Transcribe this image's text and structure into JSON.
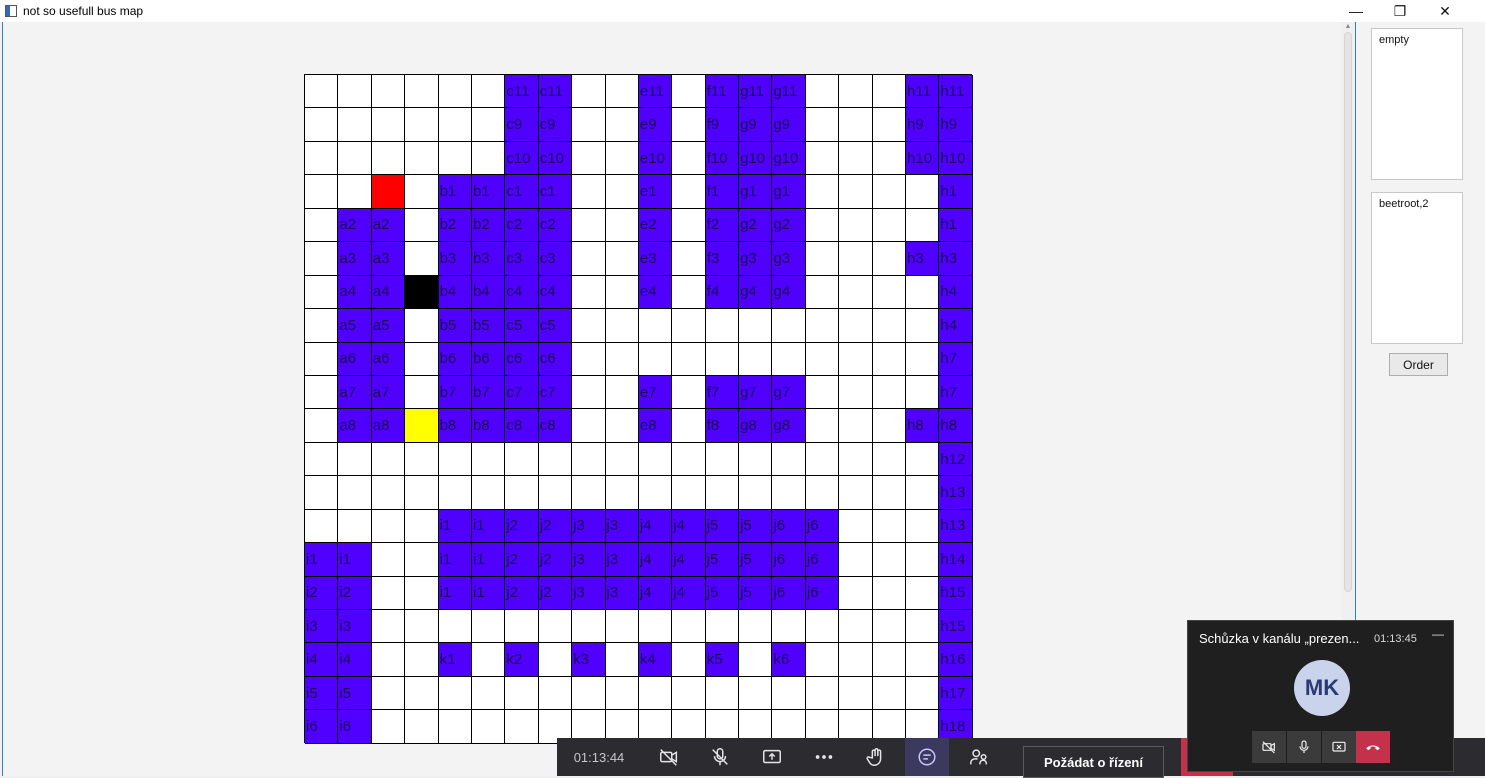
{
  "window": {
    "title": "not so usefull bus map",
    "minimize_glyph": "—",
    "maximize_glyph": "❐",
    "close_glyph": "✕"
  },
  "grid": {
    "rows": [
      [
        "",
        "",
        "",
        "",
        "",
        "",
        "c11:p",
        "c11:p",
        "",
        "",
        "e11:p",
        "",
        "f11:p",
        "g11:p",
        "g11:p",
        "",
        "",
        "",
        "h11:p",
        "h11:p"
      ],
      [
        "",
        "",
        "",
        "",
        "",
        "",
        "c9:p",
        "c9:p",
        "",
        "",
        "e9:p",
        "",
        "f9:p",
        "g9:p",
        "g9:p",
        "",
        "",
        "",
        "h9:p",
        "h9:p"
      ],
      [
        "",
        "",
        "",
        "",
        "",
        "",
        "c10:p",
        "c10:p",
        "",
        "",
        "e10:p",
        "",
        "f10:p",
        "g10:p",
        "g10:p",
        "",
        "",
        "",
        "h10:p",
        "h10:p"
      ],
      [
        "",
        "",
        ":r",
        "",
        "b1:p",
        "b1:p",
        "c1:p",
        "c1:p",
        "",
        "",
        "e1:p",
        "",
        "f1:p",
        "g1:p",
        "g1:p",
        "",
        "",
        "",
        "",
        "h1:p"
      ],
      [
        "",
        "a2:p",
        "a2:p",
        "",
        "b2:p",
        "b2:p",
        "c2:p",
        "c2:p",
        "",
        "",
        "e2:p",
        "",
        "f2:p",
        "g2:p",
        "g2:p",
        "",
        "",
        "",
        "",
        "h1:p"
      ],
      [
        "",
        "a3:p",
        "a3:p",
        "",
        "b3:p",
        "b3:p",
        "c3:p",
        "c3:p",
        "",
        "",
        "e3:p",
        "",
        "f3:p",
        "g3:p",
        "g3:p",
        "",
        "",
        "",
        "h3:p",
        "h3:p"
      ],
      [
        "",
        "a4:p",
        "a4:p",
        ":k",
        "b4:p",
        "b4:p",
        "c4:p",
        "c4:p",
        "",
        "",
        "e4:p",
        "",
        "f4:p",
        "g4:p",
        "g4:p",
        "",
        "",
        "",
        "",
        "h4:p"
      ],
      [
        "",
        "a5:p",
        "a5:p",
        "",
        "b5:p",
        "b5:p",
        "c5:p",
        "c5:p",
        "",
        "",
        "",
        "",
        "",
        "",
        "",
        "",
        "",
        "",
        "",
        "h4:p"
      ],
      [
        "",
        "a6:p",
        "a6:p",
        "",
        "b6:p",
        "b6:p",
        "c6:p",
        "c6:p",
        "",
        "",
        "",
        "",
        "",
        "",
        "",
        "",
        "",
        "",
        "",
        "h7:p"
      ],
      [
        "",
        "a7:p",
        "a7:p",
        "",
        "b7:p",
        "b7:p",
        "c7:p",
        "c7:p",
        "",
        "",
        "e7:p",
        "",
        "f7:p",
        "g7:p",
        "g7:p",
        "",
        "",
        "",
        "",
        "h7:p"
      ],
      [
        "",
        "a8:p",
        "a8:p",
        ":y",
        "b8:p",
        "b8:p",
        "c8:p",
        "c8:p",
        "",
        "",
        "e8:p",
        "",
        "f8:p",
        "g8:p",
        "g8:p",
        "",
        "",
        "",
        "h8:p",
        "h8:p"
      ],
      [
        "",
        "",
        "",
        "",
        "",
        "",
        "",
        "",
        "",
        "",
        "",
        "",
        "",
        "",
        "",
        "",
        "",
        "",
        "",
        "h12:p"
      ],
      [
        "",
        "",
        "",
        "",
        "",
        "",
        "",
        "",
        "",
        "",
        "",
        "",
        "",
        "",
        "",
        "",
        "",
        "",
        "",
        "h13:p"
      ],
      [
        "",
        "",
        "",
        "",
        "i1:p",
        "i1:p",
        "j2:p",
        "j2:p",
        "j3:p",
        "j3:p",
        "j4:p",
        "j4:p",
        "j5:p",
        "j5:p",
        "j6:p",
        "j6:p",
        "",
        "",
        "",
        "h13:p"
      ],
      [
        "i1:p",
        "i1:p",
        "",
        "",
        "i1:p",
        "i1:p",
        "j2:p",
        "j2:p",
        "j3:p",
        "j3:p",
        "j4:p",
        "j4:p",
        "j5:p",
        "j5:p",
        "j6:p",
        "j6:p",
        "",
        "",
        "",
        "h14:p"
      ],
      [
        "i2:p",
        "i2:p",
        "",
        "",
        "i1:p",
        "i1:p",
        "j2:p",
        "j2:p",
        "j3:p",
        "j3:p",
        "j4:p",
        "j4:p",
        "j5:p",
        "j5:p",
        "j6:p",
        "j6:p",
        "",
        "",
        "",
        "h15:p"
      ],
      [
        "i3:p",
        "i3:p",
        "",
        "",
        "",
        "",
        "",
        "",
        "",
        "",
        "",
        "",
        "",
        "",
        "",
        "",
        "",
        "",
        "",
        "h15:p"
      ],
      [
        "i4:p",
        "i4:p",
        "",
        "",
        "k1:p",
        "",
        "k2:p",
        "",
        "k3:p",
        "",
        "k4:p",
        "",
        "k5:p",
        "",
        "k6:p",
        "",
        "",
        "",
        "",
        "h16:p"
      ],
      [
        "i5:p",
        "i5:p",
        "",
        "",
        "",
        "",
        "",
        "",
        "",
        "",
        "",
        "",
        "",
        "",
        "",
        "",
        "",
        "",
        "",
        "h17:p"
      ],
      [
        "i6:p",
        "i6:p",
        "",
        "",
        "",
        "",
        "",
        "",
        "",
        "",
        "",
        "",
        "",
        "",
        "",
        "",
        "",
        "",
        "",
        "h18:p"
      ]
    ],
    "colors": {
      "p": "#5000ff",
      "r": "#ff0000",
      "k": "#000000",
      "y": "#ffff00",
      "empty": "#ffffff"
    }
  },
  "right_panel": {
    "list1_text": "empty",
    "list2_text": "beetroot,2",
    "order_label": "Order"
  },
  "teams_toolbar": {
    "elapsed": "01:13:44",
    "control_label": "Požádat o řízení"
  },
  "meeting_window": {
    "title": "Schůzka v kanálu „prezen...",
    "elapsed": "01:13:45",
    "minimize_glyph": "—",
    "avatar_initials": "MK"
  }
}
